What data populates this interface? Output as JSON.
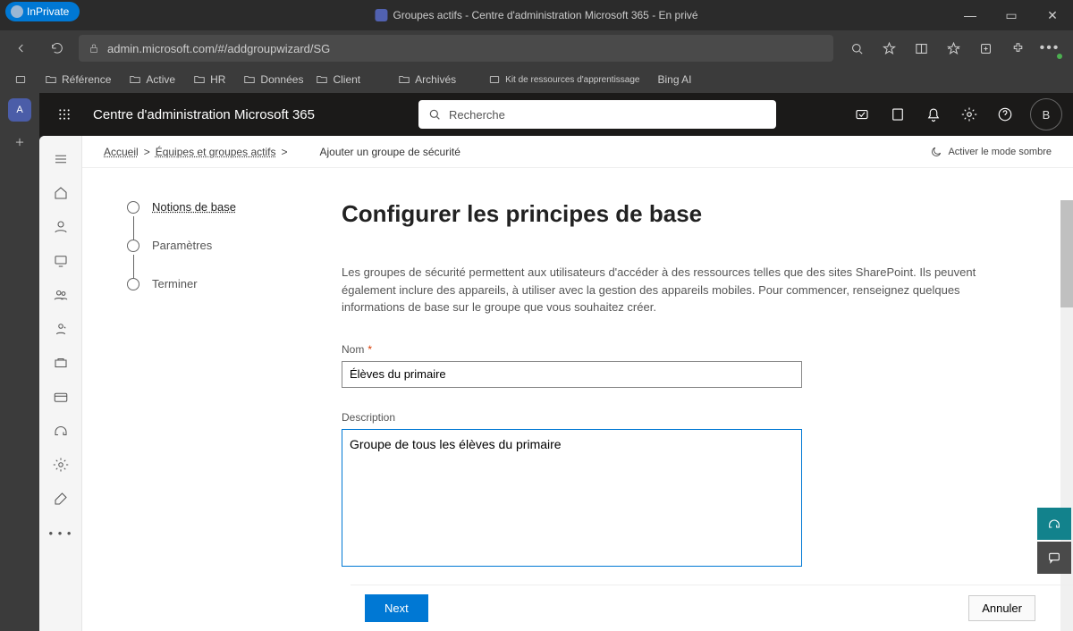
{
  "window": {
    "inprivate_label": "InPrivate",
    "tab_title": "Groupes actifs - Centre d'administration Microsoft 365 - En privé"
  },
  "address": {
    "url": "admin.microsoft.com/#/addgroupwizard/SG"
  },
  "favorites": {
    "items": [
      "Référence",
      "Active",
      "HR",
      "Données",
      "Client",
      "Archivés",
      "Kit de ressources d'apprentissage",
      "Bing AI"
    ]
  },
  "suite": {
    "title": "Centre d'administration Microsoft 365",
    "search_placeholder": "Recherche",
    "account_initial": "B"
  },
  "breadcrumb": {
    "home": "Accueil",
    "teams": "Équipes et groupes actifs",
    "sep": ">",
    "current": "Ajouter un groupe de sécurité",
    "dark_mode": "Activer le mode sombre"
  },
  "wizard": {
    "steps": [
      "Notions de base",
      "Paramètres",
      "Terminer"
    ],
    "title": "Configurer les principes de base",
    "description": "Les groupes de sécurité permettent aux utilisateurs d'accéder à des ressources telles que des sites SharePoint. Ils peuvent également inclure des appareils, à utiliser avec la gestion des appareils mobiles. Pour commencer, renseignez quelques informations de base sur le groupe que vous souhaitez créer.",
    "name_label": "Nom",
    "name_value": "Élèves du primaire",
    "desc_label": "Description",
    "desc_value": "Groupe de tous les élèves du primaire",
    "next_btn": "Next",
    "cancel_btn": "Annuler"
  }
}
